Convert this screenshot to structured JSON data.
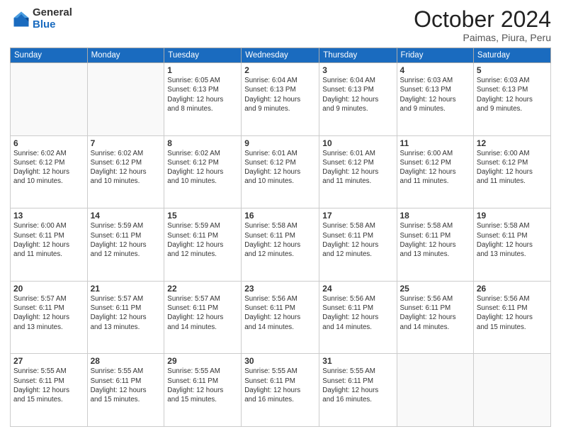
{
  "logo": {
    "general": "General",
    "blue": "Blue"
  },
  "header": {
    "month": "October 2024",
    "location": "Paimas, Piura, Peru"
  },
  "weekdays": [
    "Sunday",
    "Monday",
    "Tuesday",
    "Wednesday",
    "Thursday",
    "Friday",
    "Saturday"
  ],
  "weeks": [
    [
      {
        "day": "",
        "info": ""
      },
      {
        "day": "",
        "info": ""
      },
      {
        "day": "1",
        "info": "Sunrise: 6:05 AM\nSunset: 6:13 PM\nDaylight: 12 hours\nand 8 minutes."
      },
      {
        "day": "2",
        "info": "Sunrise: 6:04 AM\nSunset: 6:13 PM\nDaylight: 12 hours\nand 9 minutes."
      },
      {
        "day": "3",
        "info": "Sunrise: 6:04 AM\nSunset: 6:13 PM\nDaylight: 12 hours\nand 9 minutes."
      },
      {
        "day": "4",
        "info": "Sunrise: 6:03 AM\nSunset: 6:13 PM\nDaylight: 12 hours\nand 9 minutes."
      },
      {
        "day": "5",
        "info": "Sunrise: 6:03 AM\nSunset: 6:13 PM\nDaylight: 12 hours\nand 9 minutes."
      }
    ],
    [
      {
        "day": "6",
        "info": "Sunrise: 6:02 AM\nSunset: 6:12 PM\nDaylight: 12 hours\nand 10 minutes."
      },
      {
        "day": "7",
        "info": "Sunrise: 6:02 AM\nSunset: 6:12 PM\nDaylight: 12 hours\nand 10 minutes."
      },
      {
        "day": "8",
        "info": "Sunrise: 6:02 AM\nSunset: 6:12 PM\nDaylight: 12 hours\nand 10 minutes."
      },
      {
        "day": "9",
        "info": "Sunrise: 6:01 AM\nSunset: 6:12 PM\nDaylight: 12 hours\nand 10 minutes."
      },
      {
        "day": "10",
        "info": "Sunrise: 6:01 AM\nSunset: 6:12 PM\nDaylight: 12 hours\nand 11 minutes."
      },
      {
        "day": "11",
        "info": "Sunrise: 6:00 AM\nSunset: 6:12 PM\nDaylight: 12 hours\nand 11 minutes."
      },
      {
        "day": "12",
        "info": "Sunrise: 6:00 AM\nSunset: 6:12 PM\nDaylight: 12 hours\nand 11 minutes."
      }
    ],
    [
      {
        "day": "13",
        "info": "Sunrise: 6:00 AM\nSunset: 6:11 PM\nDaylight: 12 hours\nand 11 minutes."
      },
      {
        "day": "14",
        "info": "Sunrise: 5:59 AM\nSunset: 6:11 PM\nDaylight: 12 hours\nand 12 minutes."
      },
      {
        "day": "15",
        "info": "Sunrise: 5:59 AM\nSunset: 6:11 PM\nDaylight: 12 hours\nand 12 minutes."
      },
      {
        "day": "16",
        "info": "Sunrise: 5:58 AM\nSunset: 6:11 PM\nDaylight: 12 hours\nand 12 minutes."
      },
      {
        "day": "17",
        "info": "Sunrise: 5:58 AM\nSunset: 6:11 PM\nDaylight: 12 hours\nand 12 minutes."
      },
      {
        "day": "18",
        "info": "Sunrise: 5:58 AM\nSunset: 6:11 PM\nDaylight: 12 hours\nand 13 minutes."
      },
      {
        "day": "19",
        "info": "Sunrise: 5:58 AM\nSunset: 6:11 PM\nDaylight: 12 hours\nand 13 minutes."
      }
    ],
    [
      {
        "day": "20",
        "info": "Sunrise: 5:57 AM\nSunset: 6:11 PM\nDaylight: 12 hours\nand 13 minutes."
      },
      {
        "day": "21",
        "info": "Sunrise: 5:57 AM\nSunset: 6:11 PM\nDaylight: 12 hours\nand 13 minutes."
      },
      {
        "day": "22",
        "info": "Sunrise: 5:57 AM\nSunset: 6:11 PM\nDaylight: 12 hours\nand 14 minutes."
      },
      {
        "day": "23",
        "info": "Sunrise: 5:56 AM\nSunset: 6:11 PM\nDaylight: 12 hours\nand 14 minutes."
      },
      {
        "day": "24",
        "info": "Sunrise: 5:56 AM\nSunset: 6:11 PM\nDaylight: 12 hours\nand 14 minutes."
      },
      {
        "day": "25",
        "info": "Sunrise: 5:56 AM\nSunset: 6:11 PM\nDaylight: 12 hours\nand 14 minutes."
      },
      {
        "day": "26",
        "info": "Sunrise: 5:56 AM\nSunset: 6:11 PM\nDaylight: 12 hours\nand 15 minutes."
      }
    ],
    [
      {
        "day": "27",
        "info": "Sunrise: 5:55 AM\nSunset: 6:11 PM\nDaylight: 12 hours\nand 15 minutes."
      },
      {
        "day": "28",
        "info": "Sunrise: 5:55 AM\nSunset: 6:11 PM\nDaylight: 12 hours\nand 15 minutes."
      },
      {
        "day": "29",
        "info": "Sunrise: 5:55 AM\nSunset: 6:11 PM\nDaylight: 12 hours\nand 15 minutes."
      },
      {
        "day": "30",
        "info": "Sunrise: 5:55 AM\nSunset: 6:11 PM\nDaylight: 12 hours\nand 16 minutes."
      },
      {
        "day": "31",
        "info": "Sunrise: 5:55 AM\nSunset: 6:11 PM\nDaylight: 12 hours\nand 16 minutes."
      },
      {
        "day": "",
        "info": ""
      },
      {
        "day": "",
        "info": ""
      }
    ]
  ]
}
